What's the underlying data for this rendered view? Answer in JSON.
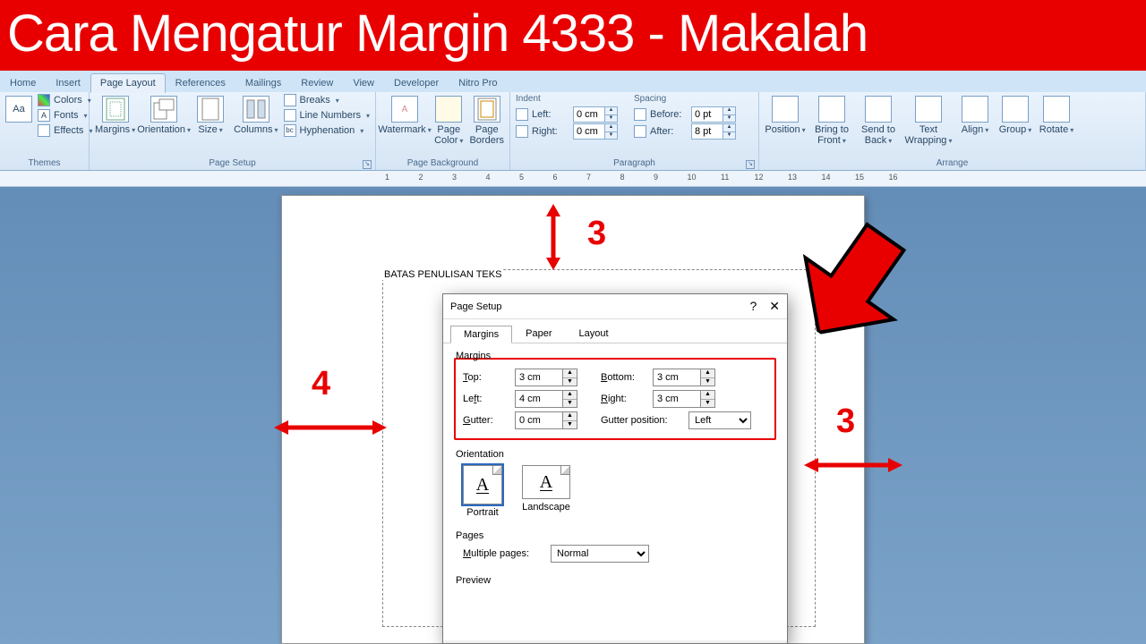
{
  "banner": "Cara Mengatur Margin 4333 - Makalah",
  "tabs": [
    "Home",
    "Insert",
    "Page Layout",
    "References",
    "Mailings",
    "Review",
    "View",
    "Developer",
    "Nitro Pro"
  ],
  "activeTab": "Page Layout",
  "ribbon": {
    "themes": {
      "label": "Themes",
      "colors": "Colors",
      "fonts": "Fonts",
      "effects": "Effects"
    },
    "pagesetup": {
      "label": "Page Setup",
      "margins": "Margins",
      "orientation": "Orientation",
      "size": "Size",
      "columns": "Columns",
      "breaks": "Breaks",
      "linenumbers": "Line Numbers",
      "hyphenation": "Hyphenation"
    },
    "pagebg": {
      "label": "Page Background",
      "watermark": "Watermark",
      "pagecolor": "Page\nColor",
      "pageborders": "Page\nBorders"
    },
    "paragraph": {
      "label": "Paragraph",
      "indent": "Indent",
      "left": "Left:",
      "right": "Right:",
      "leftv": "0 cm",
      "rightv": "0 cm",
      "spacing": "Spacing",
      "before": "Before:",
      "after": "After:",
      "beforev": "0 pt",
      "afterv": "8 pt"
    },
    "arrange": {
      "label": "Arrange",
      "position": "Position",
      "bringfront": "Bring to\nFront",
      "sendback": "Send to\nBack",
      "textwrap": "Text\nWrapping",
      "align": "Align",
      "group": "Group",
      "rotate": "Rotate"
    }
  },
  "doc": {
    "caption": "BATAS PENULISAN TEKS"
  },
  "annotations": {
    "top": "3",
    "left": "4",
    "right": "3"
  },
  "dialog": {
    "title": "Page Setup",
    "tabs": [
      "Margins",
      "Paper",
      "Layout"
    ],
    "activeTab": "Margins",
    "margins": {
      "legend": "Margins",
      "top": "Top:",
      "topv": "3 cm",
      "bottom": "Bottom:",
      "bottomv": "3 cm",
      "left": "Left:",
      "leftv": "4 cm",
      "right": "Right:",
      "rightv": "3 cm",
      "gutter": "Gutter:",
      "gutterv": "0 cm",
      "gutterpos": "Gutter position:",
      "gutterposv": "Left"
    },
    "orientation": {
      "legend": "Orientation",
      "portrait": "Portrait",
      "landscape": "Landscape"
    },
    "pages": {
      "legend": "Pages",
      "multiple": "Multiple pages:",
      "multiplev": "Normal"
    },
    "preview": "Preview"
  },
  "ruler": [
    "1",
    "2",
    "3",
    "4",
    "5",
    "6",
    "7",
    "8",
    "9",
    "10",
    "11",
    "12",
    "13",
    "14",
    "15",
    "16"
  ]
}
